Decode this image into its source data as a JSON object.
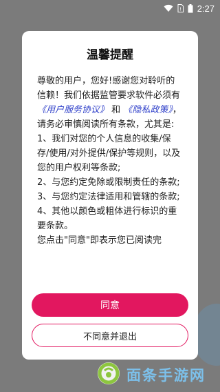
{
  "status_bar": {
    "time": "2:27",
    "icons": [
      "wifi-icon",
      "sim-icon",
      "battery-icon"
    ]
  },
  "dialog": {
    "title": "温馨提醒",
    "body": {
      "intro_1": "尊敬的用户，您好!感谢您对聆听的信赖！我们依据监管要求软件必须有",
      "link_1": "《用户服务协议》",
      "and": "和",
      "link_2": "《隐私政策》",
      "intro_2": "，请务必审慎阅读所有条款，尤其是:",
      "item_1": "1、我们对您的个人信息的收集/保存/使用/对外提供/保护等规则，以及您的用户权利等条款;",
      "item_2": "2、与您约定免除或限制责任的条款;",
      "item_3": "3、与您约定法律适用和管辖的条款;",
      "item_4": "4、其他以颜色或粗体进行标识的重要条款。",
      "closing": "您点击\"同意\"即表示您已阅读完"
    },
    "agree_label": "同意",
    "disagree_label": "不同意并退出"
  },
  "watermark": {
    "text": "面条手游网"
  },
  "colors": {
    "accent": "#e2175f",
    "link": "#2d3ec9",
    "overlay": "#7b7b7b"
  }
}
